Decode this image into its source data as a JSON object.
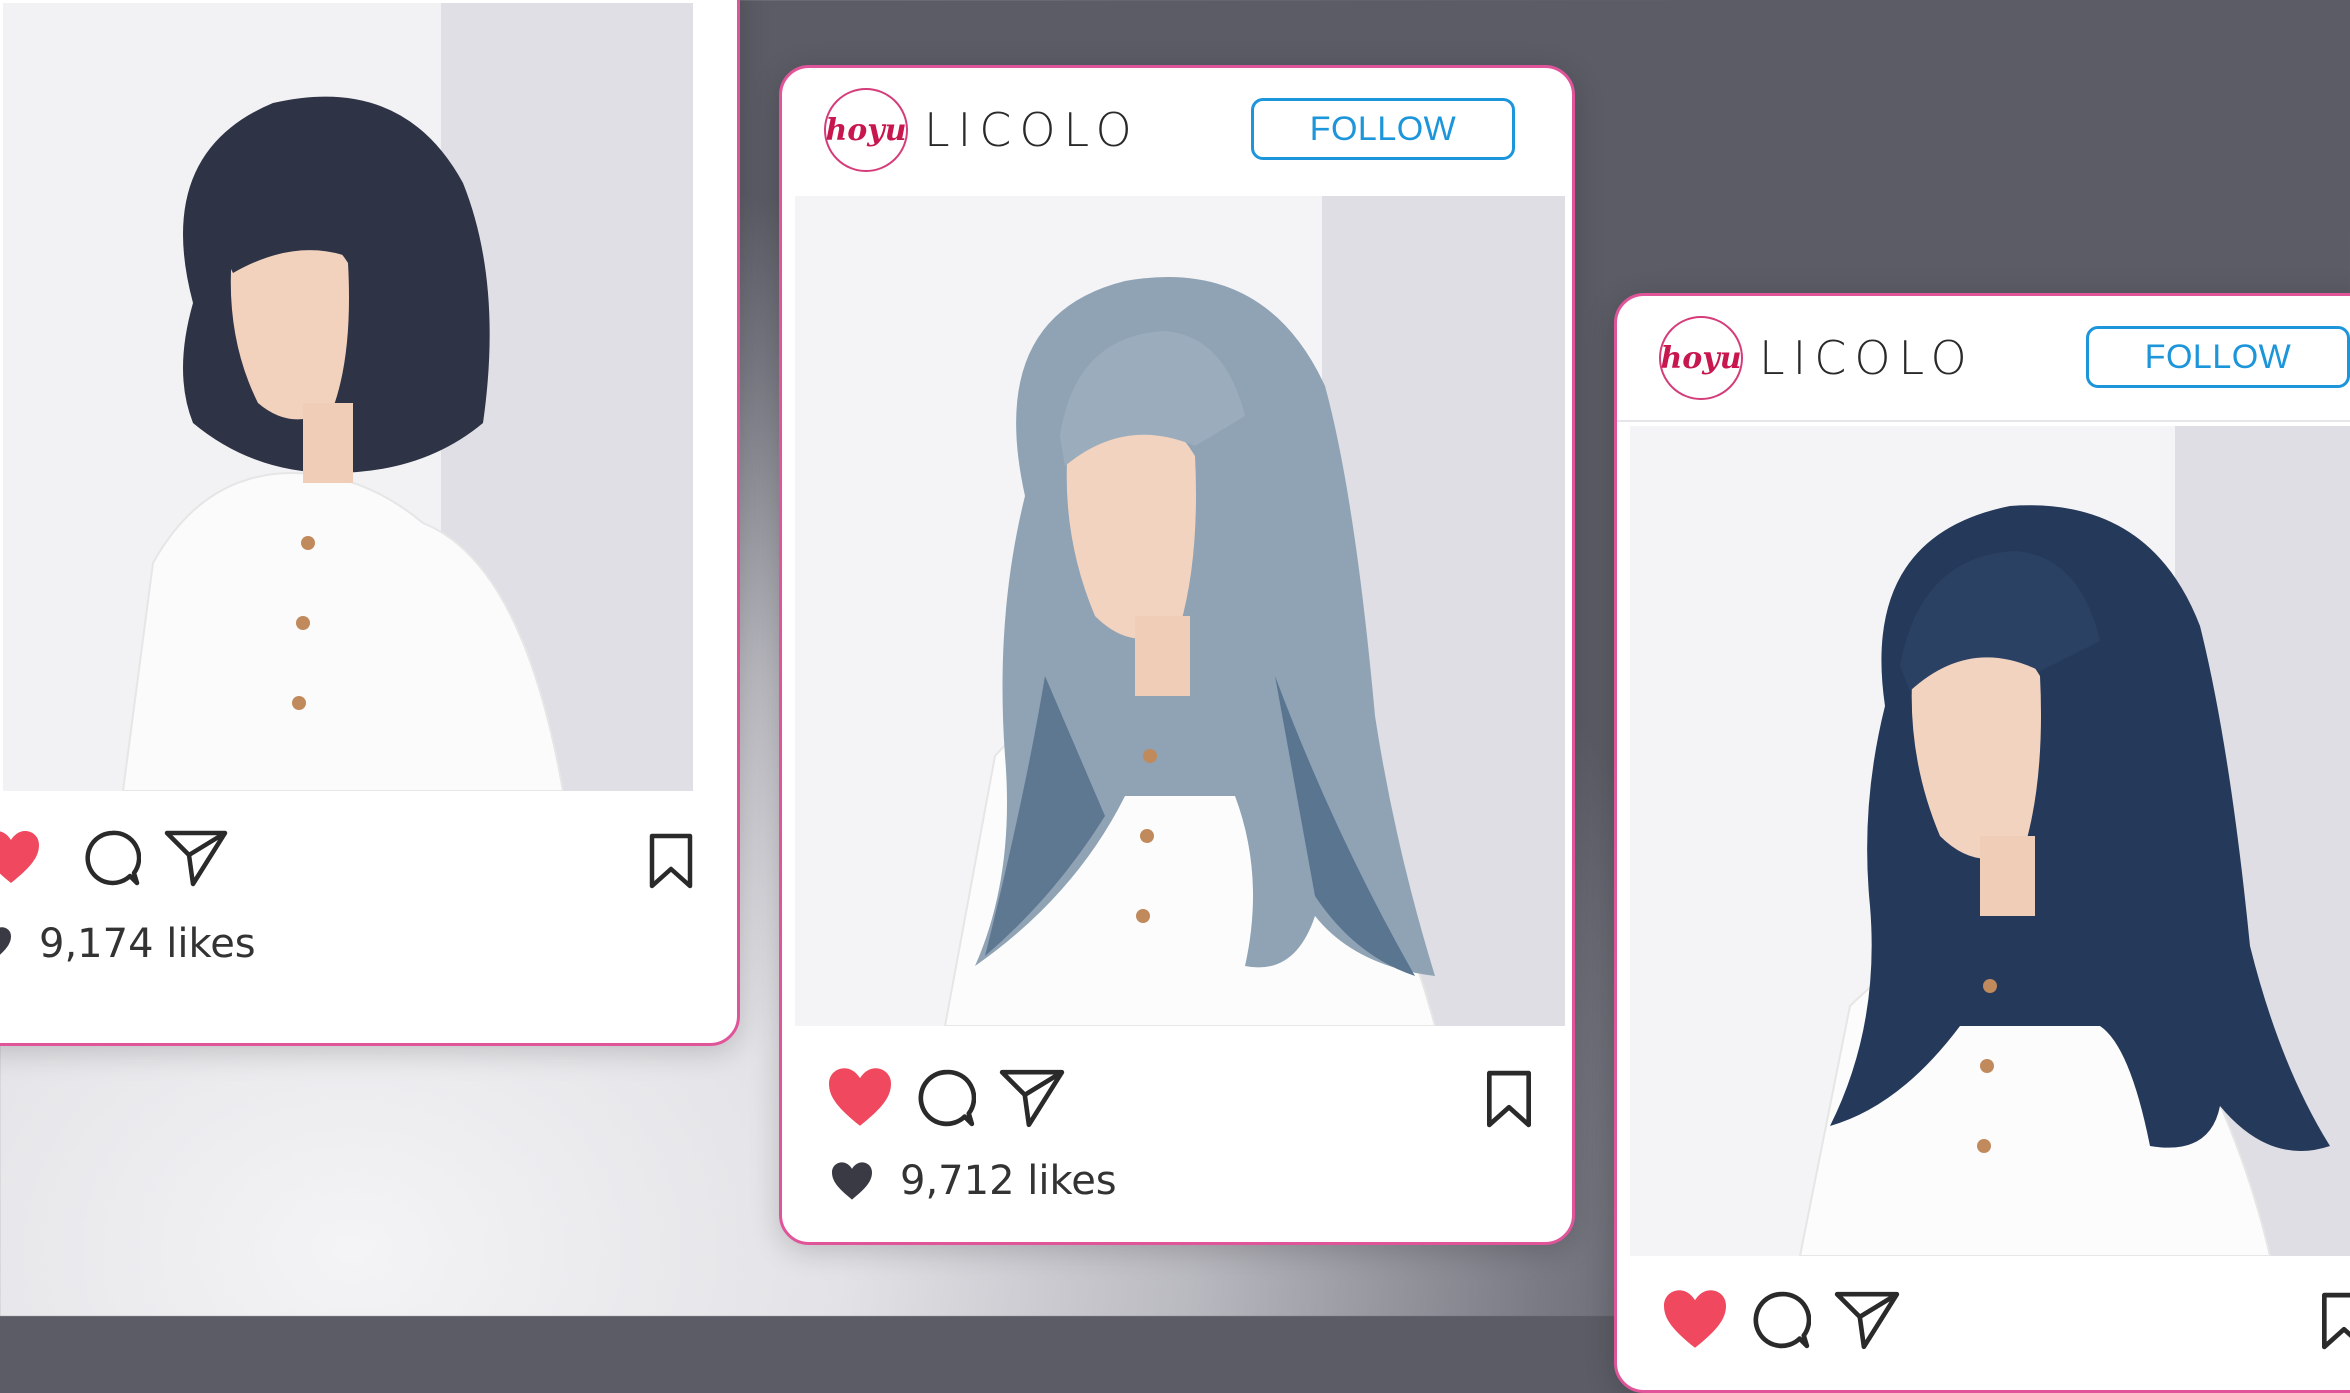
{
  "cards": [
    {
      "likes": "9,174 likes",
      "show_header": false
    },
    {
      "brand_badge": "hoyu",
      "brand_name": "LICOLO",
      "follow_label": "FOLLOW",
      "likes": "9,712 likes"
    },
    {
      "brand_badge": "hoyu",
      "brand_name": "LICOLO",
      "follow_label": "FOLLOW"
    }
  ],
  "icons": {
    "like": "heart-icon",
    "comment": "comment-icon",
    "share": "send-icon",
    "save": "bookmark-icon",
    "likes_heart": "small-heart-icon"
  },
  "colors": {
    "card_border": "#e0559a",
    "follow_blue": "#1c95da",
    "heart_red": "#f0485e",
    "brand_red": "#c8174f"
  }
}
